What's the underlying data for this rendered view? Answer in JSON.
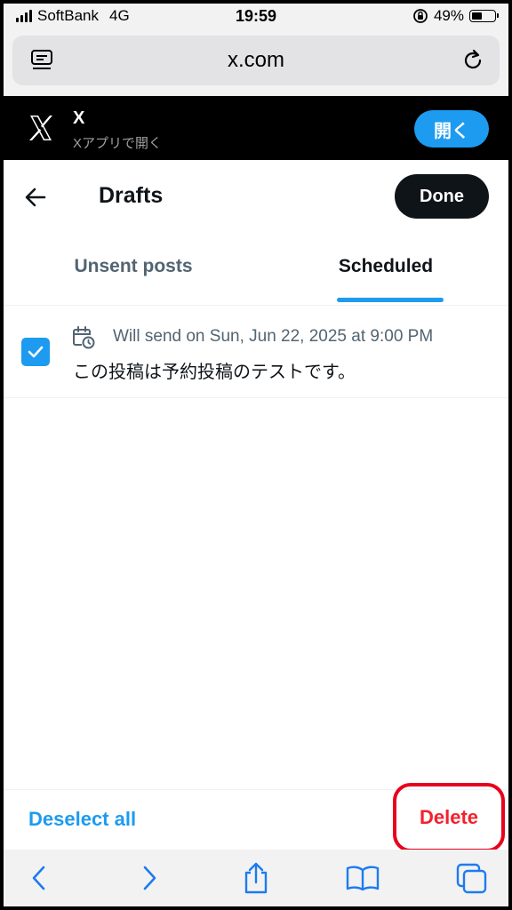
{
  "status_bar": {
    "carrier": "SoftBank",
    "network": "4G",
    "time": "19:59",
    "battery_percent": "49%",
    "battery_level": 0.49
  },
  "browser": {
    "url": "x.com"
  },
  "app_banner": {
    "app_name": "X",
    "subtitle": "Xアプリで開く",
    "open_label": "開く"
  },
  "header": {
    "title": "Drafts",
    "done_label": "Done"
  },
  "tabs": [
    {
      "label": "Unsent posts",
      "active": false
    },
    {
      "label": "Scheduled",
      "active": true
    }
  ],
  "scheduled_items": [
    {
      "checked": true,
      "schedule_text": "Will send on Sun, Jun 22, 2025 at 9:00 PM",
      "text": "この投稿は予約投稿のテストです。"
    }
  ],
  "actions": {
    "deselect_label": "Deselect all",
    "delete_label": "Delete"
  },
  "colors": {
    "accent": "#1d9bf0",
    "delete": "#f4212e",
    "highlight_outline": "#e8001c",
    "text_primary": "#0f1419",
    "text_secondary": "#536471"
  }
}
